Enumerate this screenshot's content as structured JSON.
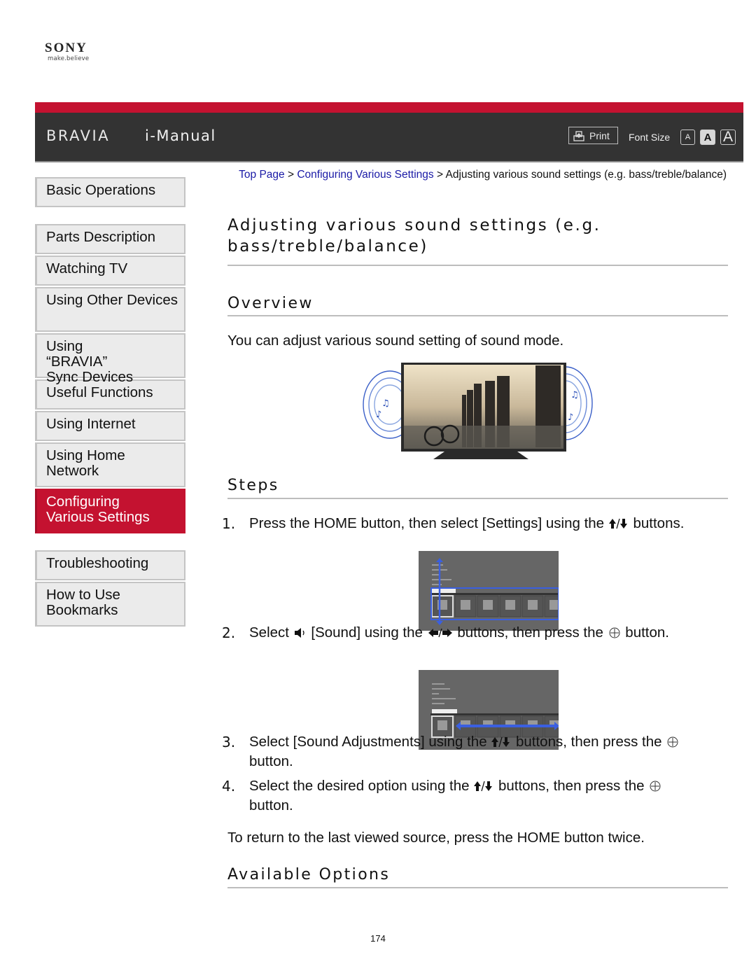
{
  "brand": {
    "company": "SONY",
    "tagline": "make.believe",
    "product": "BRAVIA",
    "app_title": "i-Manual",
    "accent_color": "#c41230",
    "header_bg": "#333333"
  },
  "toolbar": {
    "print_label": "Print",
    "font_size_label": "Font Size",
    "font_sizes": [
      {
        "label": "A",
        "name": "small",
        "selected": false
      },
      {
        "label": "A",
        "name": "medium",
        "selected": true
      },
      {
        "label": "A",
        "name": "large",
        "selected": false
      }
    ]
  },
  "breadcrumb": {
    "items": [
      {
        "label": "Top Page",
        "link": true
      },
      {
        "label": "Configuring Various Settings",
        "link": true
      },
      {
        "label": "Adjusting various sound settings (e.g. bass/treble/balance)",
        "link": false
      }
    ],
    "separator": ">"
  },
  "sidebar": {
    "groups": [
      [
        {
          "label": "Basic Operations",
          "active": false
        }
      ],
      [
        {
          "label": "Parts Description",
          "active": false
        },
        {
          "label": "Watching TV",
          "active": false
        },
        {
          "label": "Using Other Devices",
          "active": false
        },
        {
          "label": "Using “BRAVIA” Sync Devices",
          "active": false
        },
        {
          "label": "Useful Functions",
          "active": false
        },
        {
          "label": "Using Internet",
          "active": false
        },
        {
          "label": "Using Home Network",
          "active": false
        },
        {
          "label": "Configuring Various Settings",
          "active": true
        }
      ],
      [
        {
          "label": "Troubleshooting",
          "active": false
        },
        {
          "label": "How to Use Bookmarks",
          "active": false
        }
      ]
    ]
  },
  "page": {
    "title": "Adjusting various sound settings (e.g. bass/treble/balance)",
    "overview_heading": "Overview",
    "overview_text": "You can adjust various sound setting of sound mode.",
    "steps_heading": "Steps",
    "steps": [
      {
        "num": "1.",
        "parts": [
          "Press the HOME button, then select [Settings] using the ",
          "{updown}",
          " buttons."
        ]
      },
      {
        "num": "2.",
        "parts": [
          "Select ",
          "{speaker}",
          " [Sound] using the ",
          "{leftright}",
          " buttons, then press the ",
          "{enter}",
          " button."
        ]
      },
      {
        "num": "3.",
        "parts": [
          "Select [Sound Adjustments] using the ",
          "{updown}",
          " buttons, then press the ",
          "{enter}",
          " button."
        ]
      },
      {
        "num": "4.",
        "parts": [
          "Select the desired option using the ",
          "{updown}",
          " buttons, then press the ",
          "{enter}",
          " button."
        ]
      }
    ],
    "return_note": "To return to the last viewed source, press the HOME button twice.",
    "options_heading": "Available Options",
    "page_number": "174"
  },
  "icons": {
    "updown": "up-down-arrows-icon",
    "leftright": "left-right-arrows-icon",
    "speaker": "speaker-icon",
    "enter": "enter-button-icon",
    "print": "print-icon"
  }
}
